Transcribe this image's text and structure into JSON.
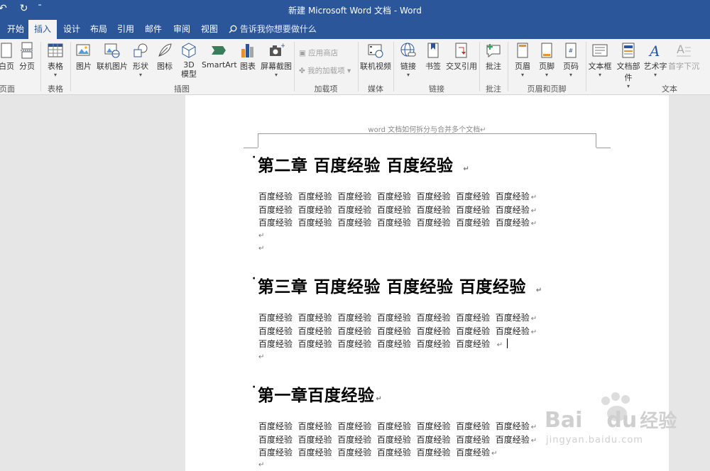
{
  "window": {
    "title": "新建 Microsoft Word 文档  -  Word"
  },
  "quick_access": {
    "undo": "↶",
    "redo": "↻",
    "more": "⁼"
  },
  "tabs": [
    "开始",
    "插入",
    "设计",
    "布局",
    "引用",
    "邮件",
    "审阅",
    "视图"
  ],
  "active_tab": "插入",
  "tell_me": "告诉我你想要做什么",
  "ribbon": {
    "buttons": {
      "blank_page": "白页",
      "page_break": "分页",
      "table": "表格",
      "picture": "图片",
      "online_picture": "联机图片",
      "shapes": "形状",
      "icons": "图标",
      "model3d": "3D\n模型",
      "smartart": "SmartArt",
      "chart": "图表",
      "screenshot": "屏幕截图",
      "store": "应用商店",
      "my_addins": "我的加载项",
      "online_video": "联机视频",
      "link": "链接",
      "bookmark": "书签",
      "cross_ref": "交叉引用",
      "comment": "批注",
      "header": "页眉",
      "footer": "页脚",
      "page_number": "页码",
      "text_box": "文本框",
      "quick_parts": "文档部件",
      "wordart": "艺术字",
      "drop_cap": "首字下沉"
    },
    "groups": {
      "pages": "页面",
      "tables": "表格",
      "illustrations": "插图",
      "addins": "加载项",
      "media": "媒体",
      "links": "链接",
      "comments": "批注",
      "header_footer": "页眉和页脚",
      "text": "文本"
    }
  },
  "document": {
    "header_text": "word 文档如何拆分与合并多个文档↵",
    "pilcrow": "↵",
    "sections": [
      {
        "heading": "第二章  百度经验  百度经验",
        "lines": [
          "百度经验  百度经验  百度经验  百度经验  百度经验  百度经验  百度经验",
          "百度经验  百度经验  百度经验  百度经验  百度经验  百度经验  百度经验",
          "百度经验  百度经验  百度经验  百度经验  百度经验  百度经验  百度经验"
        ]
      },
      {
        "heading": "第三章  百度经验  百度经验  百度经验",
        "lines": [
          "百度经验  百度经验  百度经验  百度经验  百度经验  百度经验  百度经验",
          "百度经验  百度经验  百度经验  百度经验  百度经验  百度经验  百度经验",
          "百度经验  百度经验  百度经验  百度经验  百度经验  百度经验  "
        ]
      },
      {
        "heading": "第一章百度经验",
        "lines": [
          "百度经验  百度经验  百度经验  百度经验  百度经验  百度经验  百度经验",
          "百度经验  百度经验  百度经验  百度经验  百度经验  百度经验  百度经验",
          "百度经验  百度经验  百度经验  百度经验  百度经验  百度经验"
        ]
      }
    ]
  },
  "watermark": {
    "brand": "Bai",
    "brand2": "du",
    "cn": "经验",
    "url": "jingyan.baidu.com"
  },
  "colors": {
    "accent": "#2b579a",
    "ribbon_bg": "#f3f3f3",
    "doc_bg": "#e6e6e6"
  }
}
